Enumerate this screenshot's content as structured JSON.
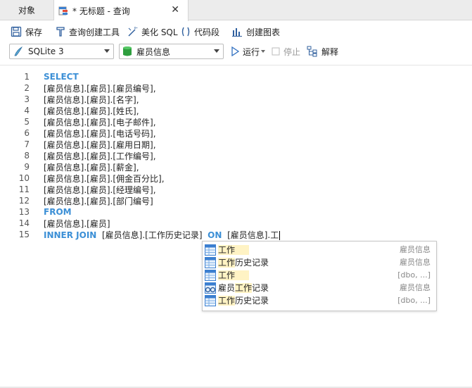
{
  "tabs": {
    "objects_label": "对象",
    "query_label": "* 无标题 - 查询",
    "close_glyph": "✕"
  },
  "toolbar": {
    "save": "保存",
    "query_builder": "查询创建工具",
    "beautify_sql": "美化 SQL",
    "code_snippet": "代码段",
    "create_chart": "创建图表"
  },
  "selectors": {
    "connection": "SQLite 3",
    "database": "雇员信息",
    "run": "运行",
    "stop": "停止",
    "explain": "解释"
  },
  "editor": {
    "lines": [
      {
        "n": "1",
        "text": "SELECT",
        "kw": true
      },
      {
        "n": "2",
        "text": "[雇员信息].[雇员].[雇员编号],"
      },
      {
        "n": "3",
        "text": "[雇员信息].[雇员].[名字],"
      },
      {
        "n": "4",
        "text": "[雇员信息].[雇员].[姓氏],"
      },
      {
        "n": "5",
        "text": "[雇员信息].[雇员].[电子邮件],"
      },
      {
        "n": "6",
        "text": "[雇员信息].[雇员].[电话号码],"
      },
      {
        "n": "7",
        "text": "[雇员信息].[雇员].[雇用日期],"
      },
      {
        "n": "8",
        "text": "[雇员信息].[雇员].[工作编号],"
      },
      {
        "n": "9",
        "text": "[雇员信息].[雇员].[薪金],"
      },
      {
        "n": "10",
        "text": "[雇员信息].[雇员].[佣金百分比],"
      },
      {
        "n": "11",
        "text": "[雇员信息].[雇员].[经理编号],"
      },
      {
        "n": "12",
        "text": "[雇员信息].[雇员].[部门编号]"
      },
      {
        "n": "13",
        "text": "FROM",
        "kw": true
      },
      {
        "n": "14",
        "text": "[雇员信息].[雇员]"
      },
      {
        "n": "15",
        "kw1": "INNER JOIN",
        "mid": "[雇员信息].[工作历史记录]",
        "kw2": "ON",
        "tail": "[雇员信息].工"
      }
    ]
  },
  "autocomplete": [
    {
      "pre": "",
      "hl": "工作",
      "post": "",
      "schema": "雇员信息",
      "icon": "table-icon"
    },
    {
      "pre": "",
      "hl": "工作",
      "post": "历史记录",
      "schema": "雇员信息",
      "icon": "table-icon"
    },
    {
      "pre": "",
      "hl": "工作",
      "post": "",
      "schema": "[dbo, ...]",
      "icon": "table-icon"
    },
    {
      "pre": "雇员",
      "hl": "工作",
      "post": "记录",
      "schema": "雇员信息",
      "icon": "view-icon"
    },
    {
      "pre": "",
      "hl": "工作",
      "post": "历史记录",
      "schema": "[dbo, ...]",
      "icon": "table-icon"
    }
  ],
  "colors": {
    "keyword": "#3b8fd6",
    "highlight": "#fff3c4",
    "db_green": "#2e9e3e"
  }
}
